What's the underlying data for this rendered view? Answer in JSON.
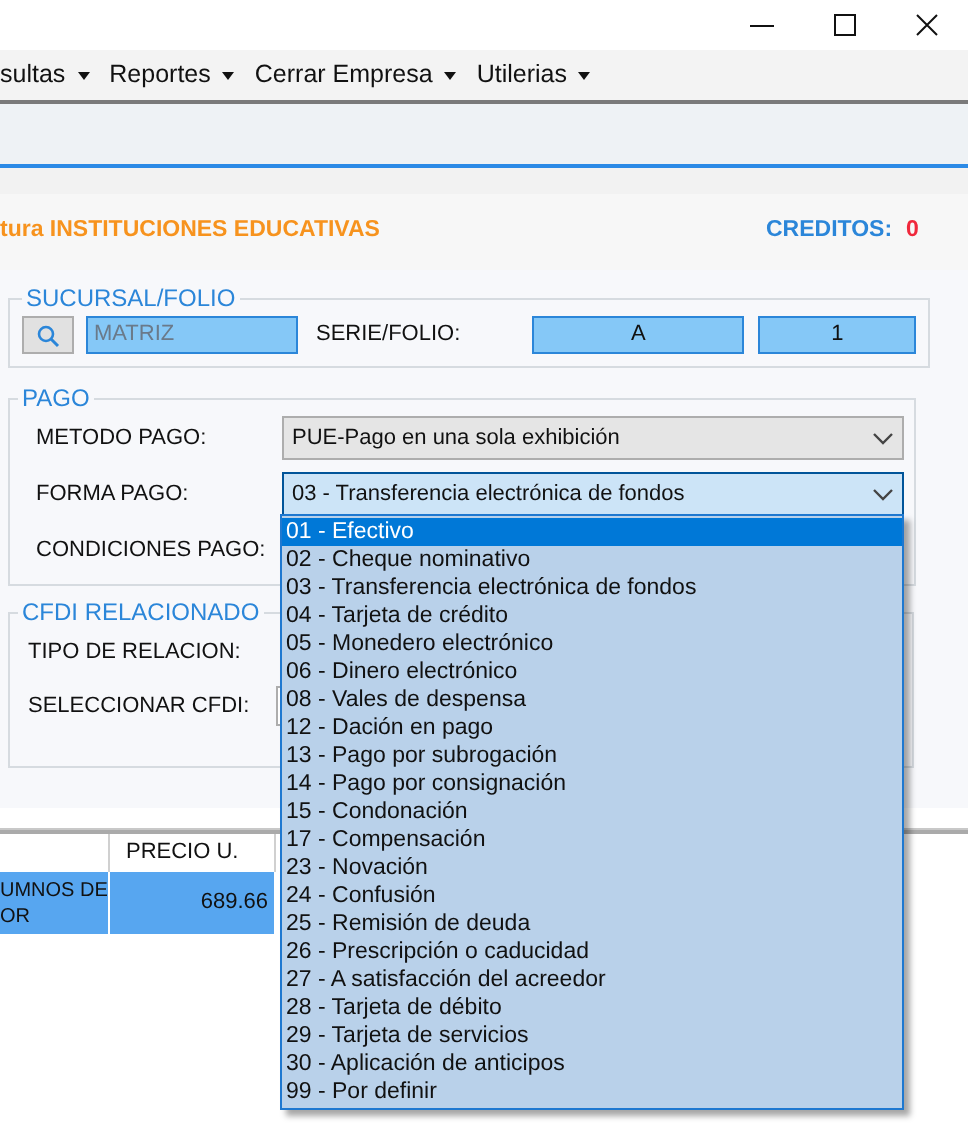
{
  "menu": [
    {
      "label": "sultas"
    },
    {
      "label": "Reportes"
    },
    {
      "label": "Cerrar Empresa"
    },
    {
      "label": "Utilerias"
    }
  ],
  "header": {
    "title": "tura INSTITUCIONES EDUCATIVAS",
    "credits_label": "CREDITOS:",
    "credits_value": "0"
  },
  "sucursal": {
    "legend": "SUCURSAL/FOLIO",
    "branch": "MATRIZ",
    "serie_label": "SERIE/FOLIO:",
    "serie": "A",
    "folio": "1"
  },
  "pago": {
    "legend": "PAGO",
    "metodo_label": "METODO PAGO:",
    "metodo_value": "PUE-Pago en una sola exhibición",
    "forma_label": "FORMA PAGO:",
    "forma_value": "03 - Transferencia electrónica de fondos",
    "condiciones_label": "CONDICIONES PAGO:"
  },
  "cfdi": {
    "legend": "CFDI RELACIONADO",
    "tipo_label": "TIPO DE RELACION:",
    "seleccionar_label": "SELECCIONAR CFDI:"
  },
  "table": {
    "columns": [
      "PRECIO U."
    ],
    "rows": [
      {
        "description": "UMNOS DE\nOR",
        "price": "689.66",
        "selected": true
      }
    ]
  },
  "dropdown": {
    "options": [
      {
        "label": "01 - Efectivo",
        "selected": true
      },
      {
        "label": "02 - Cheque nominativo",
        "selected": false
      },
      {
        "label": "03 - Transferencia electrónica de fondos",
        "selected": false
      },
      {
        "label": "04 - Tarjeta de crédito",
        "selected": false
      },
      {
        "label": "05 - Monedero electrónico",
        "selected": false
      },
      {
        "label": "06 - Dinero electrónico",
        "selected": false
      },
      {
        "label": "08 - Vales de despensa",
        "selected": false
      },
      {
        "label": "12 - Dación en pago",
        "selected": false
      },
      {
        "label": "13 - Pago por subrogación",
        "selected": false
      },
      {
        "label": "14 - Pago por consignación",
        "selected": false
      },
      {
        "label": "15 - Condonación",
        "selected": false
      },
      {
        "label": "17 - Compensación",
        "selected": false
      },
      {
        "label": "23 - Novación",
        "selected": false
      },
      {
        "label": "24 - Confusión",
        "selected": false
      },
      {
        "label": "25 - Remisión de deuda",
        "selected": false
      },
      {
        "label": "26 - Prescripción o caducidad",
        "selected": false
      },
      {
        "label": "27 - A satisfacción del acreedor",
        "selected": false
      },
      {
        "label": "28 - Tarjeta de débito",
        "selected": false
      },
      {
        "label": "29 - Tarjeta de servicios",
        "selected": false
      },
      {
        "label": "30 - Aplicación de anticipos",
        "selected": false
      },
      {
        "label": "99 - Por definir",
        "selected": false
      }
    ]
  }
}
